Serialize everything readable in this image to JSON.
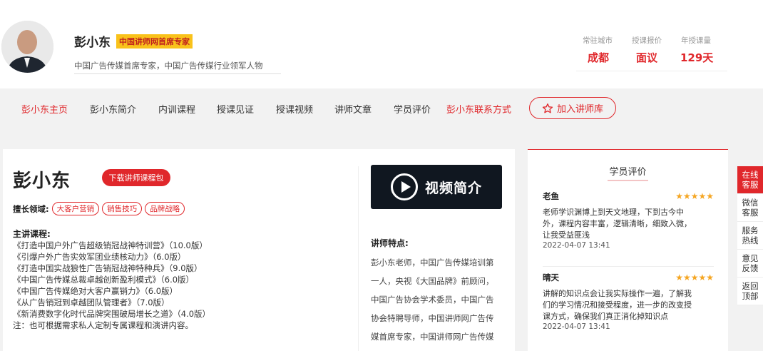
{
  "profile": {
    "name": "彭小东",
    "badge": "中国讲师网首席专家",
    "subtitle": "中国广告传媒首席专家，中国广告传媒行业领军人物",
    "stats": [
      {
        "label": "常驻城市",
        "value": "成都"
      },
      {
        "label": "授课报价",
        "value": "面议"
      },
      {
        "label": "年授课量",
        "value": "129天"
      }
    ]
  },
  "nav": {
    "items": [
      "彭小东主页",
      "彭小东简介",
      "内训课程",
      "授课见证",
      "授课视频",
      "讲师文章",
      "学员评价",
      "彭小东联系方式"
    ],
    "join_label": "加入讲师库"
  },
  "main": {
    "name": "彭小东",
    "download_label": "下载讲师课程包",
    "field_label": "擅长领域:",
    "tags": [
      "大客户营销",
      "销售技巧",
      "品牌战略"
    ],
    "courses_title": "主讲课程:",
    "courses": [
      "《打造中国户外广告超级销冠战神特训营》（10.0版）",
      "《引爆户外广告实效军团业绩核动力》（6.0版）",
      "《打造中国实战狼性广告销冠战神特种兵》（9.0版）",
      "《中国广告传媒总裁卓越创新盈利模式》（6.0版）",
      "《中国广告传媒绝对大客户赢销力》（6.0版）",
      "《从广告销冠到卓越团队管理者》（7.0版）",
      "《新消费数字化时代品牌突围破局增长之道》（4.0版）",
      "注：也可根据需求私人定制专属课程和演讲内容。"
    ],
    "video_label": "视频简介",
    "features_title": "讲师特点:",
    "features_lines": [
      "彭小东老师，中国广告传媒培训第",
      "一人，央视《大国品牌》前顾问，",
      "中国广告协会学术委员，中国广告",
      "协会特聘导师，中国讲师网广告传",
      "媒首席专家，中国讲师网广告传媒"
    ]
  },
  "reviews": {
    "title": "学员评价",
    "items": [
      {
        "name": "老鱼",
        "stars": "★★★★★",
        "lines": [
          "老师学识渊博上到天文地理，下到古今中",
          "外，课程内容丰富，逻辑清晰，细致入微，",
          "让我受益匪浅"
        ],
        "date": "2022-04-07 13:41"
      },
      {
        "name": "晴天",
        "stars": "★★★★★",
        "lines": [
          "讲解的知识点会让我实际操作一遍，了解我",
          "们的学习情况和接受程度，进一步的改变授",
          "课方式，确保我们真正消化掉知识点"
        ],
        "date": "2022-04-07 13:41"
      }
    ]
  },
  "float_bar": [
    {
      "label": "在线客服",
      "lines": [
        "在线",
        "客服"
      ]
    },
    {
      "label": "微信客服",
      "lines": [
        "微信",
        "客服"
      ]
    },
    {
      "label": "服务热线",
      "lines": [
        "服务",
        "热线"
      ]
    },
    {
      "label": "意见反馈",
      "lines": [
        "意见",
        "反馈"
      ]
    },
    {
      "label": "返回顶部",
      "lines": [
        "返回",
        "顶部"
      ]
    }
  ],
  "colors": {
    "accent": "#e0272b",
    "badge_bg": "#f9c21b",
    "star": "#f5a623"
  }
}
